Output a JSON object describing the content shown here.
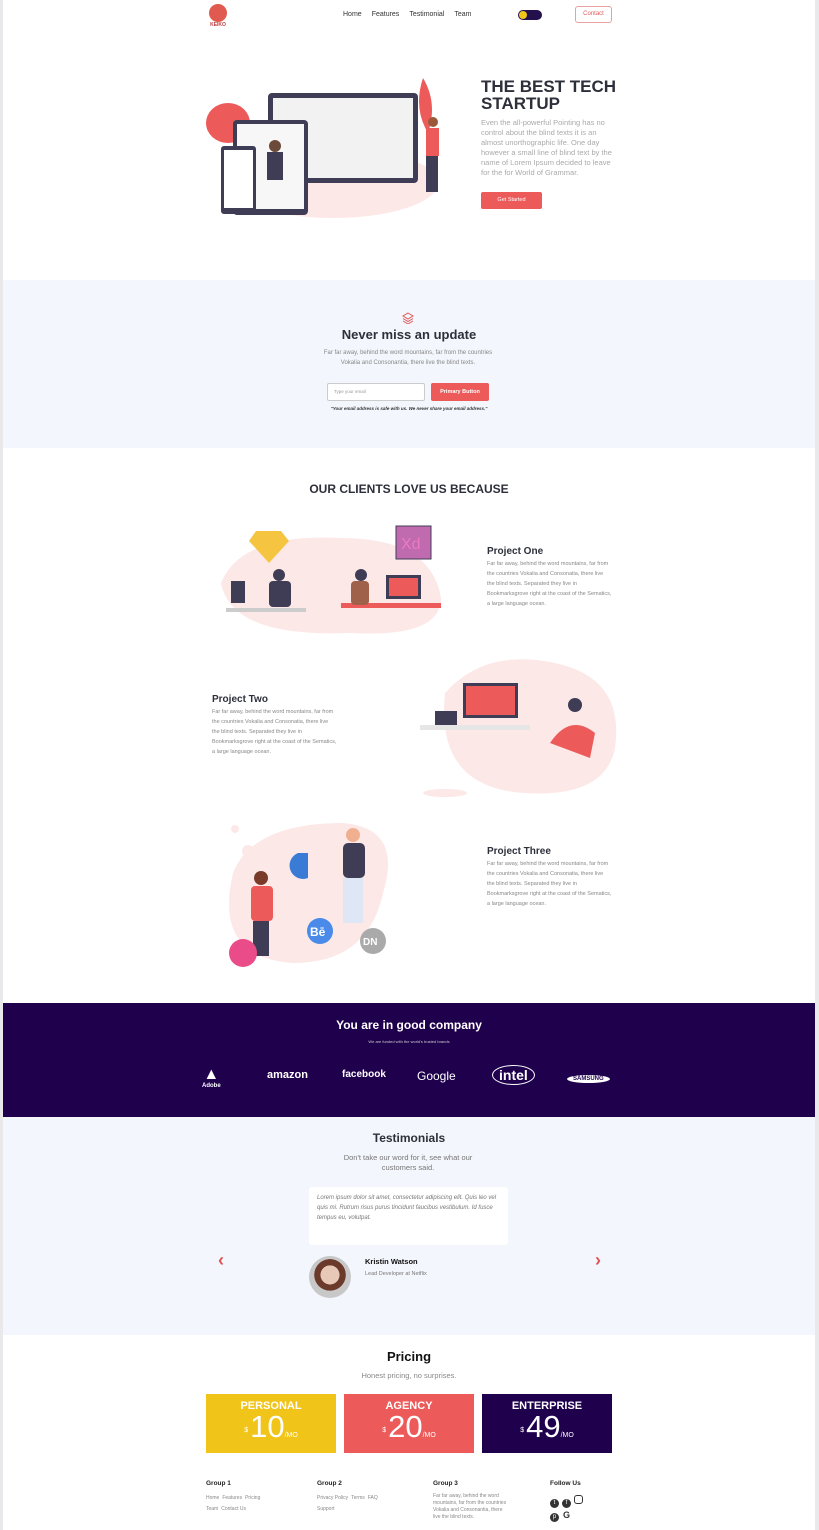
{
  "header": {
    "logo": "KEIKO",
    "nav": [
      "Home",
      "Features",
      "Testimonial",
      "Team"
    ],
    "contact": "Contact"
  },
  "hero": {
    "title": "THE BEST TECH STARTUP",
    "text": "Even the all-powerful Pointing has no control about the blind texts it is an almost unorthographic life. One day however a small line of blind text by the name of Lorem Ipsum decided to leave for the for World of Grammar.",
    "cta": "Get Started"
  },
  "update": {
    "title": "Never miss an update",
    "text": "Far far away, behind the word mountains, far from the countries Vokalia and Consonantia, there live the blind texts.",
    "placeholder": "Type your email",
    "button": "Primary Button",
    "note": "\"Your email address is safe with us. We never share your email address.\""
  },
  "clients": {
    "title": "OUR CLIENTS LOVE US BECAUSE",
    "projects": [
      {
        "title": "Project One",
        "text": "Far far away, behind the word mountains, far from the countries Vokalia and Consonatia, there live the blind texts. Separated they live in Bookmarksgrove right at the coast of the Sematics, a large language ocean."
      },
      {
        "title": "Project Two",
        "text": "Far far away, behind the word mountains, far from the countries Vokalia and Consonatia, there live the blind texts. Separated they live in Bookmarksgrove right at the coast of the Sematics, a large language ocean."
      },
      {
        "title": "Project Three",
        "text": "Far far away, behind the word mountains, far from the countries Vokalia and Consonatia, there live the blind texts. Separated they live in Bookmarksgrove right at the coast of the Sematics, a large language ocean."
      }
    ]
  },
  "company": {
    "title": "You are in good company",
    "subtitle": "We are funded with the world's trusted brands",
    "brands": [
      "Adobe",
      "amazon",
      "facebook",
      "Google",
      "intel",
      "SAMSUNG"
    ]
  },
  "testimonials": {
    "title": "Testimonials",
    "subtitle": "Don't take our word for it, see what our customers said.",
    "quote": "Lorem ipsum dolor sit amet, consectetur adipiscing elit. Quis leo vel quis mi. Rutrum risus purus tincidunt faucibus vestibulum. Id fusce tempus eu, volutpat.",
    "name": "Kristin Watson",
    "role": "Lead Developer at Netflix"
  },
  "pricing": {
    "title": "Pricing",
    "subtitle": "Honest pricing, no surprises.",
    "currency": "$",
    "period": "/MO",
    "plans": [
      {
        "name": "PERSONAL",
        "price": "10",
        "color": "#f0c419"
      },
      {
        "name": "AGENCY",
        "price": "20",
        "color": "#ec5a5a"
      },
      {
        "name": "ENTERPRISE",
        "price": "49",
        "color": "#1f004d"
      }
    ]
  },
  "footer": {
    "groups": [
      {
        "title": "Group 1",
        "links": [
          "Home",
          "Features",
          "Pricing",
          "Team",
          "Contact Us"
        ]
      },
      {
        "title": "Group 2",
        "links": [
          "Privacy Policy",
          "Terms",
          "FAQ",
          "Support"
        ]
      },
      {
        "title": "Group 3",
        "text": "Far far away, behind the word mountains, far from the countries Vokalia and Consonantia, there live the blind texts."
      }
    ],
    "follow": "Follow Us"
  }
}
